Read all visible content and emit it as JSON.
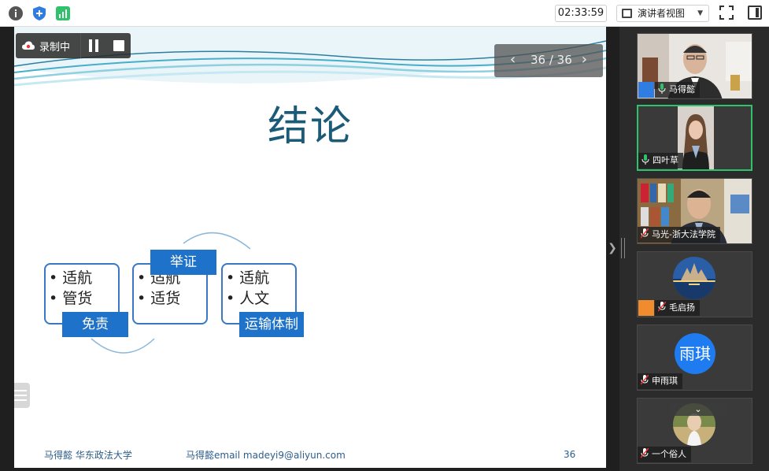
{
  "toolbar": {
    "time": "02:33:59",
    "view_mode": "演讲者视图"
  },
  "recording": {
    "label": "录制中"
  },
  "pager": {
    "text": "36 / 36",
    "prev": "‹",
    "next": "›"
  },
  "slide": {
    "title": "结论",
    "boxes": [
      {
        "bullets": [
          "• 适航",
          "• 管货"
        ],
        "tag": "免责"
      },
      {
        "bullets": [
          "• 适航",
          "• 适货"
        ],
        "tag": "举证"
      },
      {
        "bullets": [
          "• 适航",
          "• 人文"
        ],
        "tag": "运输体制"
      }
    ],
    "footer_left": "马得懿 华东政法大学",
    "footer_mid": "马得懿email madeyi9@aliyun.com",
    "page_number": "36"
  },
  "participants": [
    {
      "name": "马得懿",
      "muted": false,
      "host": true
    },
    {
      "name": "四叶草",
      "muted": false,
      "host": false
    },
    {
      "name": "马光-浙大法学院",
      "muted": true,
      "host": false
    },
    {
      "name": "毛启扬",
      "muted": true,
      "host": true
    },
    {
      "name": "申雨琪",
      "muted": true,
      "host": false,
      "avatar_text": "雨琪"
    },
    {
      "name": "一个俗人",
      "muted": true,
      "host": false
    }
  ],
  "colors": {
    "accent_blue": "#1e72c9",
    "title_blue": "#1c5b77",
    "active_green": "#2fc26b"
  }
}
